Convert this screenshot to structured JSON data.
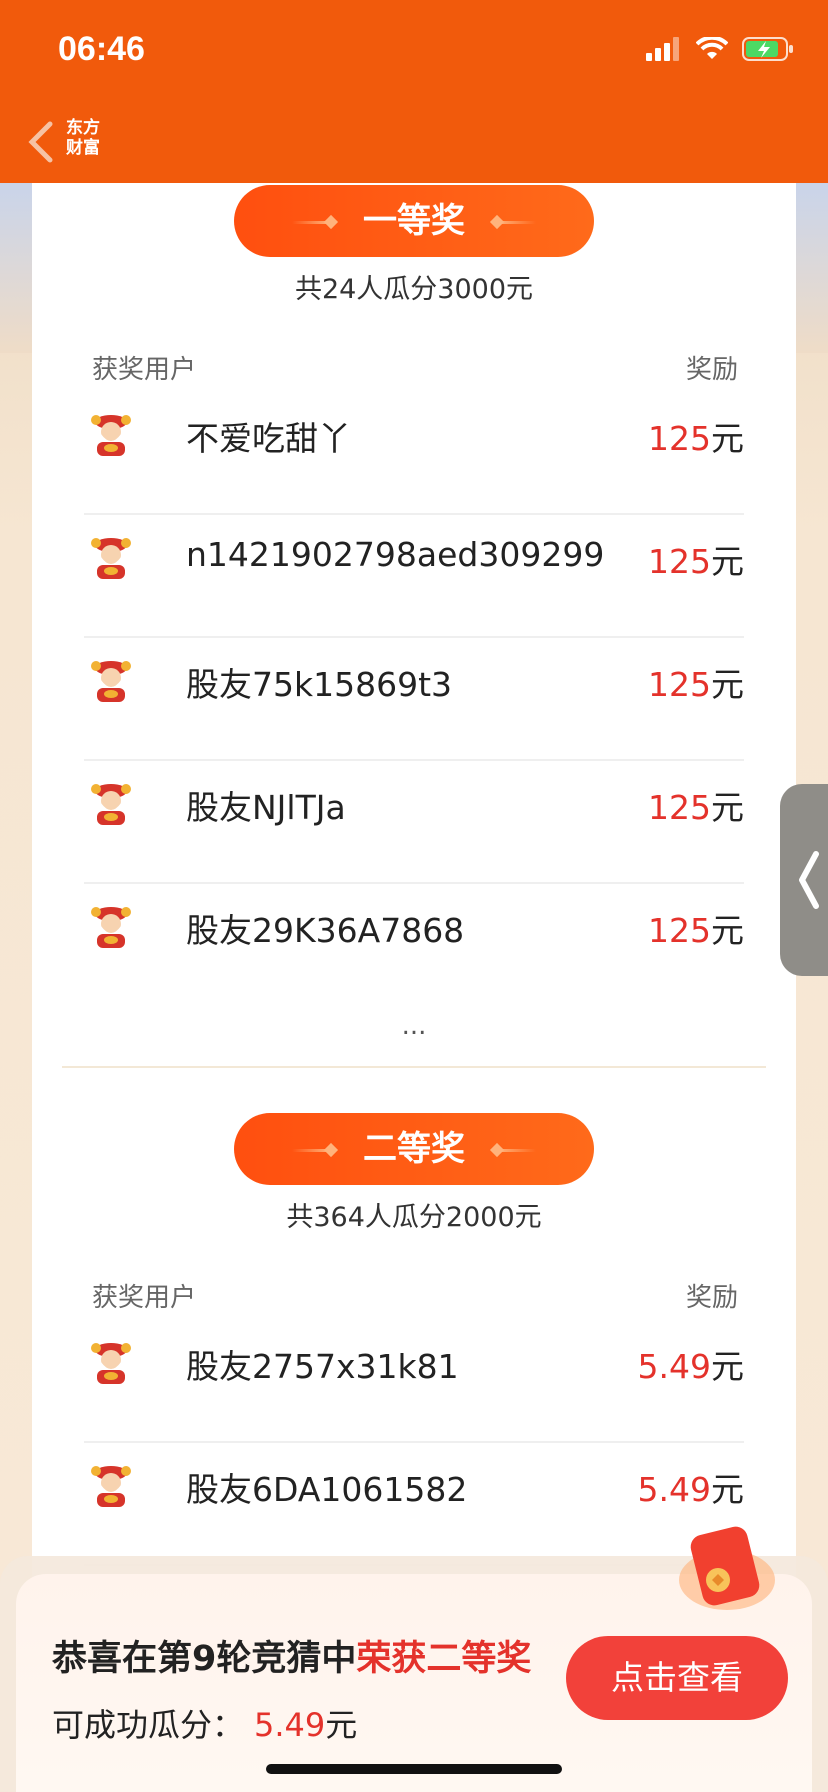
{
  "status_bar": {
    "time": "06:46"
  },
  "nav": {
    "logo_line1": "东方",
    "logo_line2": "财富"
  },
  "prize_sections": [
    {
      "title": "一等奖",
      "subtitle": "共24人瓜分3000元",
      "col_user": "获奖用户",
      "col_reward": "奖励",
      "winners": [
        {
          "name": "不爱吃甜丫",
          "amount": "125",
          "unit": "元"
        },
        {
          "name": "n1421902798aed309299",
          "amount": "125",
          "unit": "元"
        },
        {
          "name": "股友75k15869t3",
          "amount": "125",
          "unit": "元"
        },
        {
          "name": "股友NJlTJa",
          "amount": "125",
          "unit": "元"
        },
        {
          "name": "股友29K36A7868",
          "amount": "125",
          "unit": "元"
        }
      ],
      "more": "..."
    },
    {
      "title": "二等奖",
      "subtitle": "共364人瓜分2000元",
      "col_user": "获奖用户",
      "col_reward": "奖励",
      "winners": [
        {
          "name": "股友2757x31k81",
          "amount": "5.49",
          "unit": "元"
        },
        {
          "name": "股友6DA1061582",
          "amount": "5.49",
          "unit": "元"
        }
      ]
    }
  ],
  "popup": {
    "line1_prefix": "恭喜在第9轮竞猜中",
    "line1_highlight": "荣获二等奖",
    "line2_label": "可成功瓜分：",
    "line2_amount": "5.49",
    "line2_unit": "元",
    "button_label": "点击查看"
  },
  "colors": {
    "brand": "#f15a0c",
    "accent": "#e4322b",
    "pill": "#ff5a14"
  },
  "icons": [
    "back-chevron-icon",
    "signal-icon",
    "wifi-icon",
    "battery-icon",
    "avatar-icon",
    "side-collapse-icon",
    "red-packet-icon"
  ]
}
